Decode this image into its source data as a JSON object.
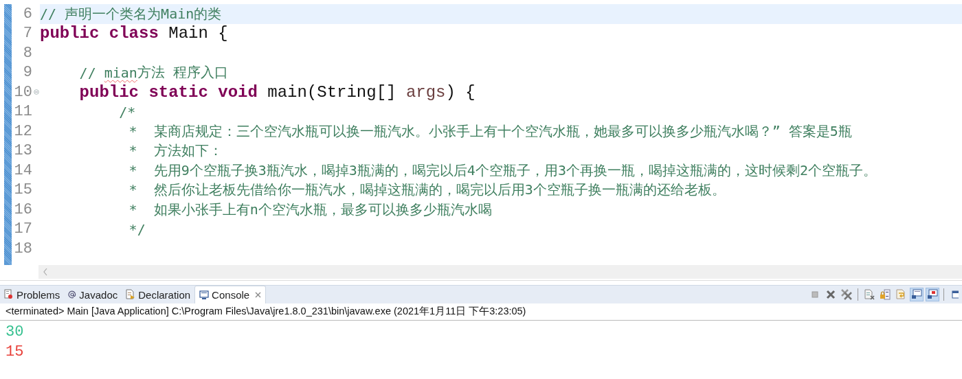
{
  "editor": {
    "lines": [
      {
        "number": "6",
        "current": true,
        "fold": false,
        "tokens": [
          {
            "kind": "comment",
            "text": "// 声明一个类名为Main的类"
          }
        ]
      },
      {
        "number": "7",
        "current": false,
        "fold": false,
        "tokens": [
          {
            "kind": "keyword",
            "text": "public class"
          },
          {
            "kind": "plain",
            "text": " Main {"
          }
        ]
      },
      {
        "number": "8",
        "current": false,
        "fold": false
      },
      {
        "number": "9",
        "current": false,
        "fold": false,
        "tokens": [
          {
            "kind": "comment",
            "text": "// "
          },
          {
            "kind": "misspelled",
            "text": "mian"
          },
          {
            "kind": "comment",
            "text": "方法 程序入口"
          }
        ]
      },
      {
        "number": "10",
        "current": false,
        "fold": true,
        "tokens": [
          {
            "kind": "keyword",
            "text": "public static void"
          },
          {
            "kind": "plain",
            "text": " main(String[] "
          },
          {
            "kind": "param",
            "text": "args"
          },
          {
            "kind": "plain",
            "text": ") {"
          }
        ]
      },
      {
        "number": "11",
        "current": false,
        "fold": false,
        "tokens": [
          {
            "kind": "comment",
            "text": "/*"
          }
        ]
      },
      {
        "number": "12",
        "current": false,
        "fold": false,
        "tokens": [
          {
            "kind": "comment",
            "text": "*  某商店规定：三个空汽水瓶可以换一瓶汽水。小张手上有十个空汽水瓶，她最多可以换多少瓶汽水喝？” 答案是5瓶"
          }
        ]
      },
      {
        "number": "13",
        "current": false,
        "fold": false,
        "tokens": [
          {
            "kind": "comment",
            "text": "*  方法如下："
          }
        ]
      },
      {
        "number": "14",
        "current": false,
        "fold": false,
        "tokens": [
          {
            "kind": "comment",
            "text": "*  先用9个空瓶子换3瓶汽水，喝掉3瓶满的，喝完以后4个空瓶子，用3个再换一瓶，喝掉这瓶满的，这时候剩2个空瓶子。"
          }
        ]
      },
      {
        "number": "15",
        "current": false,
        "fold": false,
        "tokens": [
          {
            "kind": "comment",
            "text": "*  然后你让老板先借给你一瓶汽水，喝掉这瓶满的，喝完以后用3个空瓶子换一瓶满的还给老板。"
          }
        ]
      },
      {
        "number": "16",
        "current": false,
        "fold": false,
        "tokens": [
          {
            "kind": "comment",
            "text": "*  如果小张手上有n个空汽水瓶，最多可以换多少瓶汽水喝"
          }
        ]
      },
      {
        "number": "17",
        "current": false,
        "fold": false,
        "tokens": [
          {
            "kind": "comment",
            "text": "*/"
          }
        ]
      },
      {
        "number": "18",
        "current": false,
        "fold": false
      }
    ]
  },
  "panel": {
    "tabs": [
      {
        "label": "Problems",
        "selected": false
      },
      {
        "label": "Javadoc",
        "selected": false
      },
      {
        "label": "Declaration",
        "selected": false
      },
      {
        "label": "Console",
        "selected": true
      }
    ],
    "toolbar": [
      {
        "kind": "stop",
        "selected": false
      },
      {
        "kind": "remove",
        "selected": false
      },
      {
        "kind": "remove-all",
        "selected": false
      },
      {
        "kind": "clear",
        "selected": false
      },
      {
        "kind": "scroll-lock",
        "selected": false
      },
      {
        "kind": "word-wrap",
        "selected": false
      },
      {
        "kind": "show-out",
        "selected": true
      },
      {
        "kind": "show-err",
        "selected": true
      },
      {
        "kind": "window",
        "selected": false
      }
    ],
    "status": "<terminated> Main [Java Application] C:\\Program Files\\Java\\jre1.8.0_231\\bin\\javaw.exe (2021年1月11日 下午3:23:05)",
    "output": [
      {
        "text": "30",
        "color": "#35c08f"
      },
      {
        "text": "15",
        "color": "#e8413a"
      }
    ]
  }
}
